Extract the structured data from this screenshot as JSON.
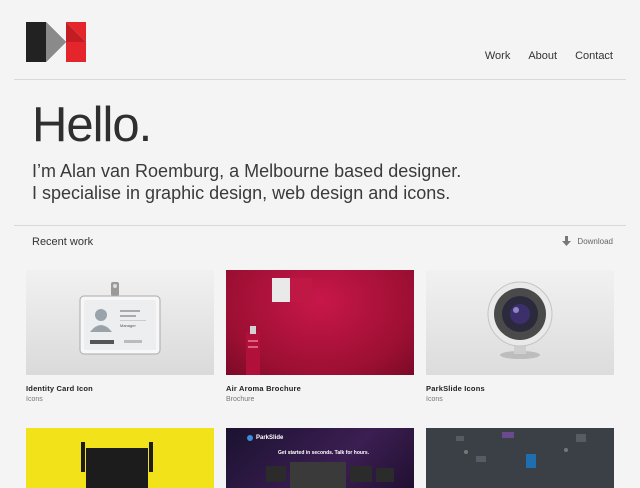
{
  "nav": {
    "items": [
      "Work",
      "About",
      "Contact"
    ]
  },
  "hero": {
    "heading": "Hello.",
    "line1": "I’m Alan van Roemburg, a Melbourne based designer.",
    "line2": "I specialise in graphic design, web design and icons."
  },
  "recent": {
    "title": "Recent work",
    "download": "Download"
  },
  "projects": [
    {
      "title": "Identity Card Icon",
      "category": "Icons",
      "card_text": [
        "Manager"
      ]
    },
    {
      "title": "Air Aroma Brochure",
      "category": "Brochure"
    },
    {
      "title": "ParkSlide Icons",
      "category": "Icons"
    }
  ],
  "row2": {
    "parkslide_logo": "ParkSlide",
    "parkslide_tagline": "Get started in seconds. Talk for hours."
  },
  "colors": {
    "logo_red": "#e4252b",
    "logo_dark": "#222222",
    "logo_grey": "#8a8a8a",
    "brochure_red": "#b0123a",
    "yellow": "#f2e21a"
  }
}
